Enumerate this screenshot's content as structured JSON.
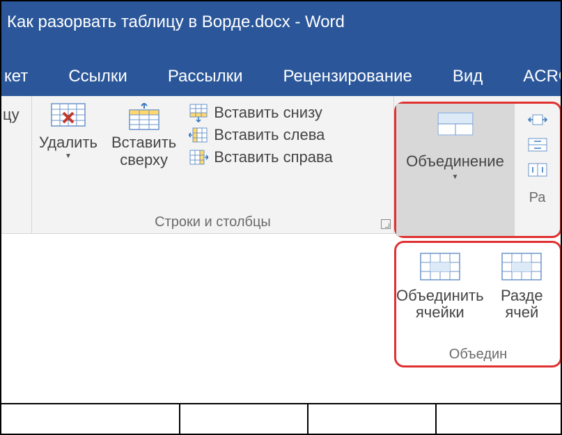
{
  "title": "Как разорвать таблицу в Ворде.docx - Word",
  "tabs": {
    "maket": "кет",
    "links": "Ссылки",
    "mailings": "Рассылки",
    "review": "Рецензирование",
    "view": "Вид",
    "acrobat": "ACROBAT"
  },
  "ribbon": {
    "partial_btn": "цу",
    "delete": "Удалить",
    "insert_above": "Вставить\nсверху",
    "insert_below": "Вставить снизу",
    "insert_left": "Вставить слева",
    "insert_right": "Вставить справа",
    "group_rowscols": "Строки и столбцы",
    "merge_dropdown": "Объединение",
    "size_partial": "Ра"
  },
  "popup": {
    "merge_cells": "Объединить\nячейки",
    "split_cells": "Разде\nячей",
    "group_label": "Объедин"
  }
}
